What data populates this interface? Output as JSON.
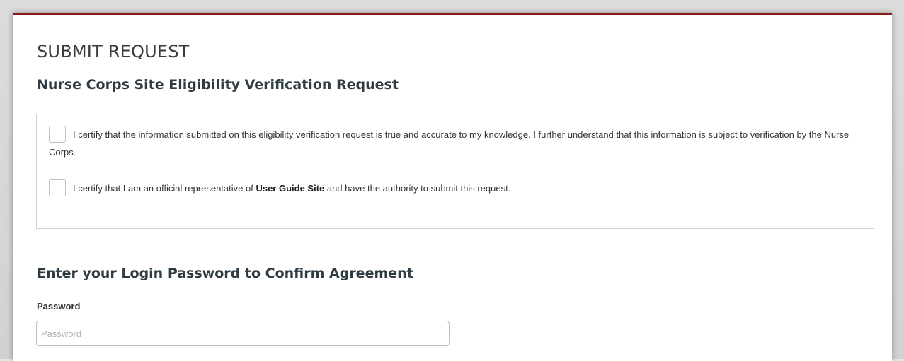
{
  "page": {
    "title": "SUBMIT REQUEST",
    "subtitle": "Nurse Corps Site Eligibility Verification Request",
    "accent_color": "#8b1a1a"
  },
  "certifications": [
    {
      "checked": false,
      "text": "I certify that the information submitted on this eligibility verification request is true and accurate to my knowledge. I further understand that this information is subject to verification by the Nurse Corps."
    },
    {
      "checked": false,
      "text_before": "I certify that I am an official representative of ",
      "site_name": "User Guide Site",
      "text_after": " and have the authority to submit this request."
    }
  ],
  "confirm": {
    "heading": "Enter your Login Password to Confirm Agreement",
    "password_label": "Password",
    "password_placeholder": "Password",
    "password_value": ""
  }
}
